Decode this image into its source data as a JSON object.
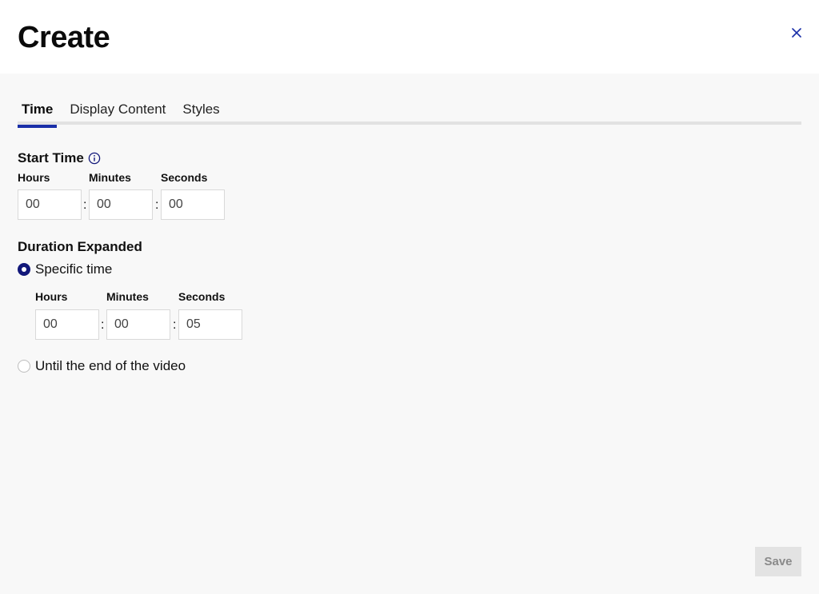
{
  "dialog": {
    "title": "Create",
    "close_icon": "close-icon"
  },
  "tabs": [
    {
      "label": "Time",
      "active": true
    },
    {
      "label": "Display Content",
      "active": false
    },
    {
      "label": "Styles",
      "active": false
    }
  ],
  "start_time": {
    "title": "Start Time",
    "info_icon": "info-icon",
    "hours_label": "Hours",
    "minutes_label": "Minutes",
    "seconds_label": "Seconds",
    "hours": "00",
    "minutes": "00",
    "seconds": "00",
    "separator": ":"
  },
  "duration": {
    "title": "Duration Expanded",
    "specific": {
      "label": "Specific time",
      "selected": true,
      "hours_label": "Hours",
      "minutes_label": "Minutes",
      "seconds_label": "Seconds",
      "hours": "00",
      "minutes": "00",
      "seconds": "05",
      "separator": ":"
    },
    "until_end": {
      "label": "Until the end of the video",
      "selected": false
    }
  },
  "footer": {
    "save_label": "Save"
  },
  "colors": {
    "accent": "#1a2fa8",
    "radio_checked": "#12187a",
    "save_disabled_bg": "#e3e3e3"
  }
}
